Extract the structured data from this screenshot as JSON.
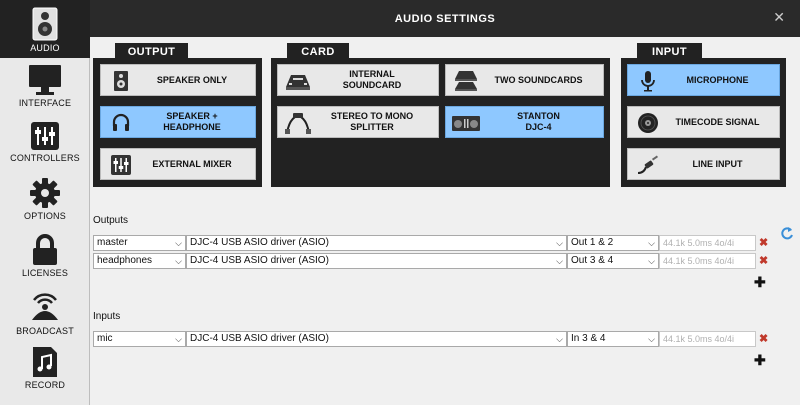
{
  "window": {
    "title": "AUDIO SETTINGS",
    "close_glyph": "✕"
  },
  "sidebar": {
    "items": [
      {
        "label": "AUDIO",
        "icon": "speaker-icon",
        "active": true
      },
      {
        "label": "INTERFACE",
        "icon": "monitor-icon"
      },
      {
        "label": "CONTROLLERS",
        "icon": "sliders-icon"
      },
      {
        "label": "OPTIONS",
        "icon": "gear-icon"
      },
      {
        "label": "LICENSES",
        "icon": "lock-icon"
      },
      {
        "label": "BROADCAST",
        "icon": "broadcast-icon"
      },
      {
        "label": "RECORD",
        "icon": "music-file-icon"
      }
    ]
  },
  "output": {
    "title": "OUTPUT",
    "options": [
      {
        "label": "SPEAKER ONLY",
        "icon": "speaker-icon"
      },
      {
        "label": "SPEAKER +\nHEADPHONE",
        "icon": "headphones-icon",
        "selected": true
      },
      {
        "label": "EXTERNAL MIXER",
        "icon": "mixer-icon"
      }
    ]
  },
  "card": {
    "title": "CARD",
    "options": [
      {
        "label": "INTERNAL\nSOUNDCARD",
        "icon": "soundcard-icon"
      },
      {
        "label": "TWO SOUNDCARDS",
        "icon": "two-soundcards-icon"
      },
      {
        "label": "STEREO TO MONO\nSPLITTER",
        "icon": "splitter-cable-icon"
      },
      {
        "label": "STANTON\nDJC-4",
        "icon": "controller-icon",
        "selected": true
      }
    ]
  },
  "input": {
    "title": "INPUT",
    "options": [
      {
        "label": "MICROPHONE",
        "icon": "microphone-icon",
        "selected": true
      },
      {
        "label": "TIMECODE SIGNAL",
        "icon": "vinyl-icon"
      },
      {
        "label": "LINE INPUT",
        "icon": "cable-jack-icon"
      }
    ]
  },
  "outputs_section": {
    "label": "Outputs",
    "rows": [
      {
        "channel": "master",
        "driver": "DJC-4 USB ASIO driver (ASIO)",
        "port": "Out 1 & 2",
        "info": "44.1k 5.0ms 4o/4i"
      },
      {
        "channel": "headphones",
        "driver": "DJC-4 USB ASIO driver (ASIO)",
        "port": "Out 3 & 4",
        "info": "44.1k 5.0ms 4o/4i"
      }
    ]
  },
  "inputs_section": {
    "label": "Inputs",
    "rows": [
      {
        "channel": "mic",
        "driver": "DJC-4 USB ASIO driver (ASIO)",
        "port": "In 3 & 4",
        "info": "44.1k 5.0ms 4o/4i"
      }
    ]
  },
  "glyphs": {
    "chevron": "⌵",
    "delete": "✖",
    "add": "✚"
  },
  "colors": {
    "accent": "#8ec8ff",
    "panel_dark": "#222222",
    "delete_red": "#c0392b"
  }
}
